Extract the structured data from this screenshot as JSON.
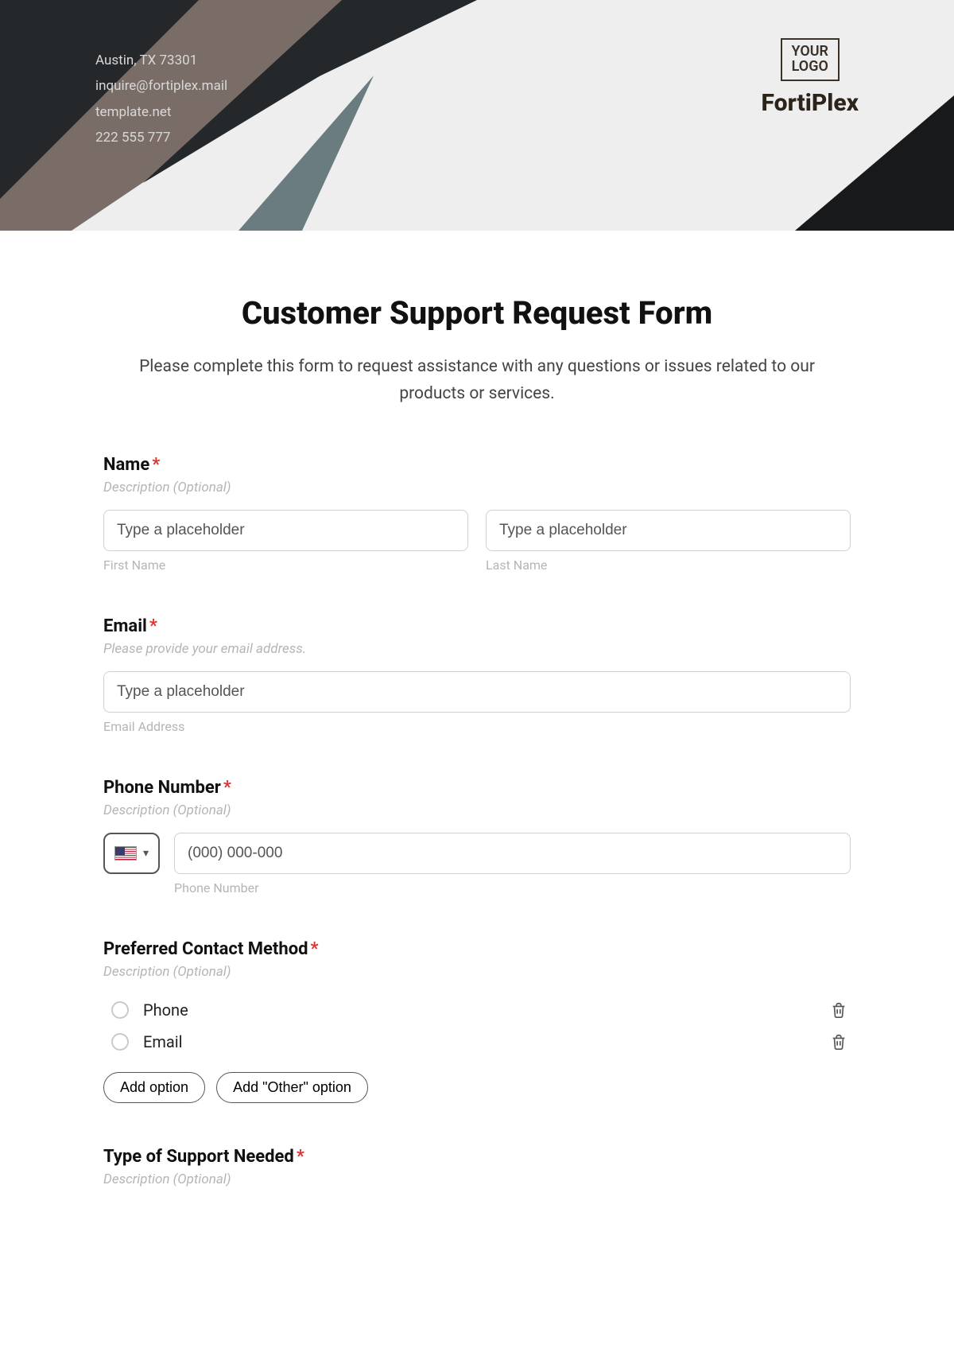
{
  "header": {
    "address": "Austin, TX 73301",
    "email": "inquire@fortiplex.mail",
    "website": "template.net",
    "phone": "222 555 777",
    "logo_text_line1": "YOUR",
    "logo_text_line2": "LOGO",
    "brand": "FortiPlex"
  },
  "form": {
    "title": "Customer Support Request Form",
    "intro": "Please complete this form to request assistance with any questions or issues related to our products or services.",
    "name": {
      "label": "Name",
      "required_mark": "*",
      "description": "Description (Optional)",
      "first_placeholder": "Type a placeholder",
      "first_sublabel": "First Name",
      "last_placeholder": "Type a placeholder",
      "last_sublabel": "Last Name"
    },
    "email": {
      "label": "Email",
      "required_mark": "*",
      "description": "Please provide your email address.",
      "placeholder": "Type a placeholder",
      "sublabel": "Email Address"
    },
    "phone": {
      "label": "Phone Number",
      "required_mark": "*",
      "description": "Description (Optional)",
      "placeholder": "(000) 000-000",
      "sublabel": "Phone Number"
    },
    "contact_method": {
      "label": "Preferred Contact Method",
      "required_mark": "*",
      "description": "Description (Optional)",
      "options": [
        "Phone",
        "Email"
      ],
      "add_option": "Add option",
      "add_other": "Add \"Other\" option"
    },
    "support_type": {
      "label": "Type of Support Needed",
      "required_mark": "*",
      "description": "Description (Optional)"
    }
  }
}
